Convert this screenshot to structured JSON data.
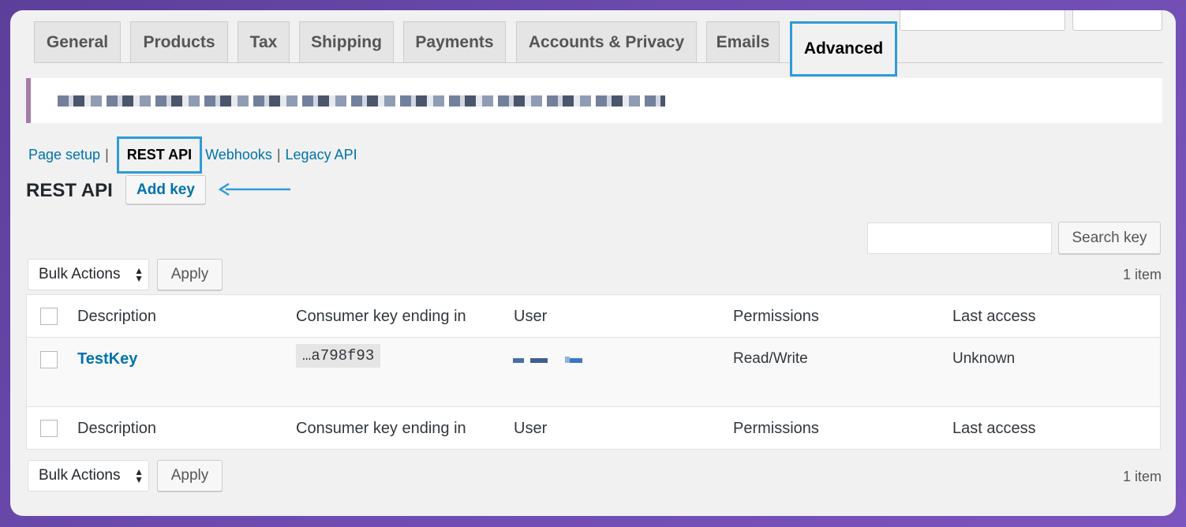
{
  "tabs": [
    {
      "label": "General"
    },
    {
      "label": "Products"
    },
    {
      "label": "Tax"
    },
    {
      "label": "Shipping"
    },
    {
      "label": "Payments"
    },
    {
      "label": "Accounts & Privacy"
    },
    {
      "label": "Emails"
    },
    {
      "label": "Advanced",
      "active": true
    }
  ],
  "subnav": {
    "page_setup": "Page setup",
    "rest_api": "REST API",
    "webhooks": "Webhooks",
    "legacy_api": "Legacy API",
    "separator": "|"
  },
  "heading": "REST API",
  "add_key_label": "Add key",
  "search": {
    "button_label": "Search key",
    "value": ""
  },
  "bulk": {
    "selected": "Bulk Actions",
    "apply_label": "Apply"
  },
  "item_count": "1 item",
  "table": {
    "columns": [
      "Description",
      "Consumer key ending in",
      "User",
      "Permissions",
      "Last access"
    ],
    "rows": [
      {
        "description": "TestKey",
        "key": "…a798f93",
        "permissions": "Read/Write",
        "last_access": "Unknown"
      }
    ]
  },
  "colors": {
    "accent": "#2e9bd8",
    "link": "#0073aa",
    "notice_border": "#a37da8"
  }
}
